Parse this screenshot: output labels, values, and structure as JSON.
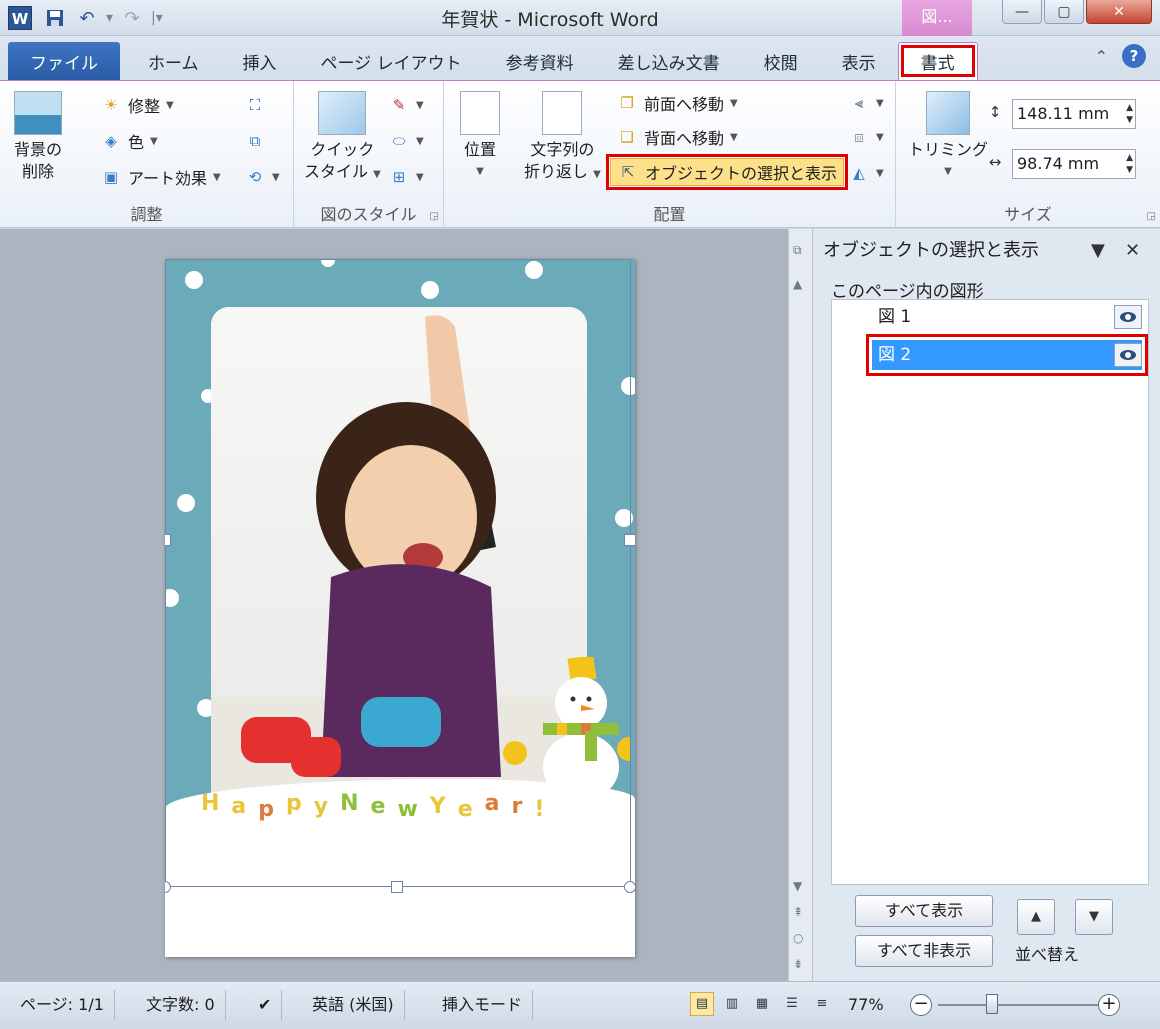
{
  "title_bar": {
    "app_icon": "W",
    "title": "年賀状 - Microsoft Word",
    "context_tab": "図...",
    "minimize": "—",
    "maximize": "▢",
    "close": "✕"
  },
  "tabs": [
    {
      "label": "ファイル"
    },
    {
      "label": "ホーム"
    },
    {
      "label": "挿入"
    },
    {
      "label": "ページ レイアウト"
    },
    {
      "label": "参考資料"
    },
    {
      "label": "差し込み文書"
    },
    {
      "label": "校閲"
    },
    {
      "label": "表示"
    },
    {
      "label": "書式"
    }
  ],
  "ribbon": {
    "adjust": {
      "remove_bg": "背景の",
      "remove_bg2": "削除",
      "corrections": "修整",
      "color": "色",
      "art_effects": "アート効果",
      "label": "調整"
    },
    "picture_styles": {
      "quick1": "クイック",
      "quick2": "スタイル",
      "label": "図のスタイル"
    },
    "arrange": {
      "position": "位置",
      "wrap1": "文字列の",
      "wrap2": "折り返し",
      "bring_forward": "前面へ移動",
      "send_backward": "背面へ移動",
      "selection_pane": "オブジェクトの選択と表示",
      "label": "配置"
    },
    "size": {
      "crop": "トリミング",
      "height": "148.11 mm",
      "width": "98.74 mm",
      "label": "サイズ"
    }
  },
  "document": {
    "greeting_letters": [
      {
        "ch": "H",
        "color": "#e8c53a"
      },
      {
        "ch": "a",
        "color": "#e8c53a"
      },
      {
        "ch": "p",
        "color": "#e07a3a"
      },
      {
        "ch": "p",
        "color": "#e8c53a"
      },
      {
        "ch": "y",
        "color": "#e8c53a"
      },
      {
        "ch": " ",
        "color": "#ffffff"
      },
      {
        "ch": "N",
        "color": "#8fbf3a"
      },
      {
        "ch": "e",
        "color": "#8fbf3a"
      },
      {
        "ch": "w",
        "color": "#8fbf3a"
      },
      {
        "ch": " ",
        "color": "#ffffff"
      },
      {
        "ch": "Y",
        "color": "#e8c53a"
      },
      {
        "ch": "e",
        "color": "#e8c53a"
      },
      {
        "ch": "a",
        "color": "#e07a3a"
      },
      {
        "ch": "r",
        "color": "#e07a3a"
      },
      {
        "ch": "!",
        "color": "#e8c53a"
      }
    ]
  },
  "selection_pane": {
    "title": "オブジェクトの選択と表示",
    "subtitle": "このページ内の図形",
    "items": [
      {
        "label": "図 1"
      },
      {
        "label": "図 2"
      }
    ],
    "show_all": "すべて表示",
    "hide_all": "すべて非表示",
    "reorder": "並べ替え"
  },
  "status_bar": {
    "page": "ページ: 1/1",
    "words": "文字数: 0",
    "language": "英語 (米国)",
    "mode": "挿入モード",
    "zoom": "77%"
  },
  "colors": {
    "accent_red": "#e00000",
    "card_blue": "#6aaab9",
    "selection_blue": "#3399ff"
  }
}
